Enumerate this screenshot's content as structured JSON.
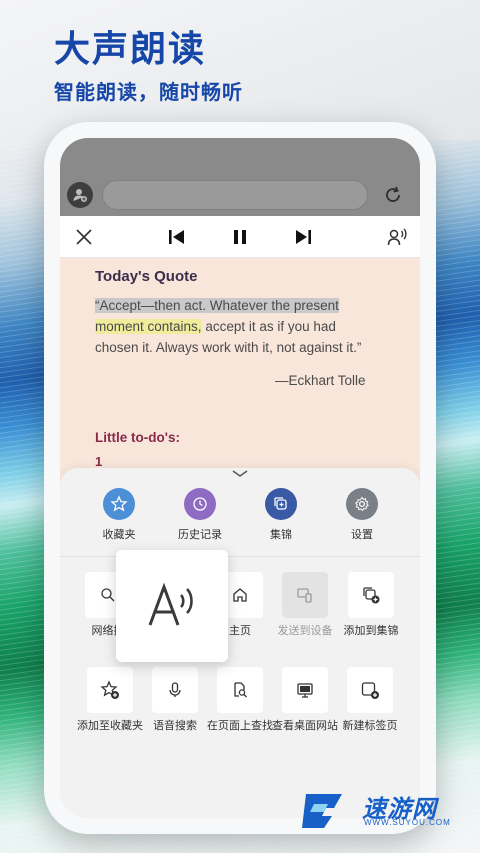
{
  "promo": {
    "headline": "大声朗读",
    "subline": "智能朗读，随时畅听"
  },
  "browser": {
    "avatar_icon": "user-plus-icon",
    "refresh_icon": "refresh-icon"
  },
  "player": {
    "close_icon": "close-icon",
    "prev_icon": "skip-previous-icon",
    "pause_icon": "pause-icon",
    "next_icon": "skip-next-icon",
    "voice_icon": "voice-settings-icon"
  },
  "article": {
    "title": "Today's Quote",
    "line1_hl": "“Accept—then act. Whatever the present",
    "line2_hl": "moment contains,",
    "line2_rest": " accept it as if you had",
    "line3": "chosen it. Always work with it, not against it.”",
    "author": "—Eckhart Tolle",
    "todo_title": "Little to-do's:",
    "todo_num": "1"
  },
  "menu": {
    "favorites": [
      {
        "label": "收藏夹",
        "icon": "star-icon",
        "color": "#4c8fd6"
      },
      {
        "label": "历史记录",
        "icon": "history-icon",
        "color": "#8e6cc4"
      },
      {
        "label": "集锦",
        "icon": "collections-icon",
        "color": "#3a5aa6"
      },
      {
        "label": "设置",
        "icon": "gear-icon",
        "color": "#7a7f88"
      }
    ],
    "row1": [
      {
        "label": "网络搜",
        "icon": "search-icon"
      },
      {
        "label": "主页",
        "icon": "home-icon"
      },
      {
        "label": "发送到设备",
        "icon": "send-to-device-icon",
        "disabled": true
      },
      {
        "label": "添加到集锦",
        "icon": "add-to-collection-icon"
      }
    ],
    "row2": [
      {
        "label": "添加至收藏夹",
        "icon": "add-favorite-icon"
      },
      {
        "label": "语音搜索",
        "icon": "microphone-icon"
      },
      {
        "label": "在页面上查找",
        "icon": "find-in-page-icon"
      },
      {
        "label": "查看桌面网站",
        "icon": "desktop-site-icon"
      },
      {
        "label": "新建标签页",
        "icon": "new-tab-icon"
      }
    ],
    "popup_icon": "read-aloud-icon"
  },
  "watermark": {
    "text": "速游网",
    "sub": "WWW.SUYOU.COM"
  }
}
